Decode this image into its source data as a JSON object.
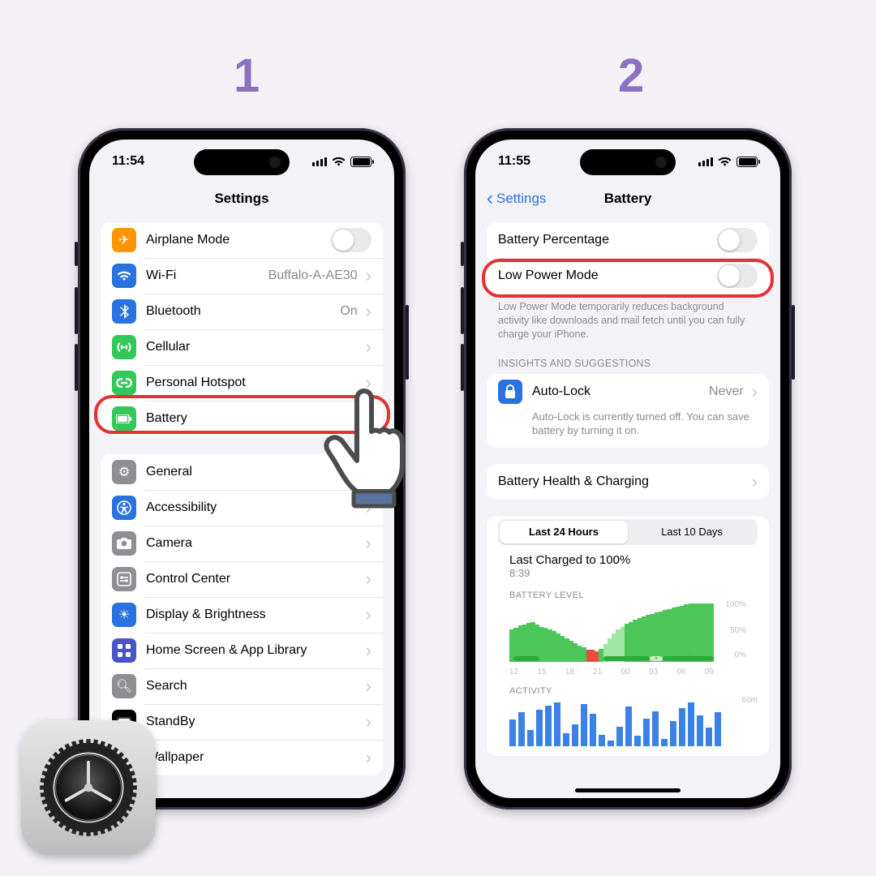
{
  "steps": {
    "one": "1",
    "two": "2"
  },
  "p1": {
    "time": "11:54",
    "title": "Settings",
    "groups": [
      {
        "items": [
          {
            "label": "Airplane Mode"
          },
          {
            "label": "Wi-Fi",
            "value": "Buffalo-A-AE30"
          },
          {
            "label": "Bluetooth",
            "value": "On"
          },
          {
            "label": "Cellular"
          },
          {
            "label": "Personal Hotspot"
          },
          {
            "label": "Battery"
          }
        ]
      },
      {
        "items": [
          {
            "label": "General"
          },
          {
            "label": "Accessibility"
          },
          {
            "label": "Camera"
          },
          {
            "label": "Control Center"
          },
          {
            "label": "Display & Brightness"
          },
          {
            "label": "Home Screen & App Library"
          },
          {
            "label": "Search"
          },
          {
            "label": "StandBy"
          },
          {
            "label": "Wallpaper"
          }
        ]
      }
    ]
  },
  "p2": {
    "time": "11:55",
    "back": "Settings",
    "title": "Battery",
    "rows": {
      "percentage": "Battery Percentage",
      "lowpower": "Low Power Mode",
      "lowpower_note": "Low Power Mode temporarily reduces background activity like downloads and mail fetch until you can fully charge your iPhone.",
      "insights_header": "INSIGHTS AND SUGGESTIONS",
      "autolock": "Auto-Lock",
      "autolock_val": "Never",
      "autolock_note": "Auto-Lock is currently turned off. You can save battery by turning it on.",
      "health": "Battery Health & Charging",
      "seg_a": "Last 24 Hours",
      "seg_b": "Last 10 Days",
      "charged_title": "Last Charged to 100%",
      "charged_time": "8:39",
      "level_head": "BATTERY LEVEL",
      "activity_head": "ACTIVITY"
    }
  },
  "chart_data": {
    "type": "bar",
    "title": "BATTERY LEVEL",
    "ylabel": "Percent",
    "ylim": [
      0,
      100
    ],
    "y_ticks": [
      "100%",
      "50%",
      "0%"
    ],
    "x_ticks": [
      "12",
      "15",
      "18",
      "21",
      "00",
      "03",
      "06",
      "09"
    ],
    "series": [
      {
        "name": "battery_level_pct",
        "values": [
          55,
          58,
          62,
          64,
          66,
          68,
          64,
          60,
          58,
          55,
          52,
          48,
          44,
          40,
          36,
          32,
          28,
          24,
          20,
          20,
          18,
          22,
          30,
          40,
          48,
          55,
          60,
          65,
          68,
          72,
          75,
          78,
          80,
          82,
          84,
          86,
          88,
          90,
          92,
          94,
          96,
          98,
          99,
          100,
          100,
          100,
          100,
          100
        ]
      },
      {
        "name": "low_battery_flag",
        "values": [
          0,
          0,
          0,
          0,
          0,
          0,
          0,
          0,
          0,
          0,
          0,
          0,
          0,
          0,
          0,
          0,
          0,
          0,
          1,
          1,
          1,
          0,
          0,
          0,
          0,
          0,
          0,
          0,
          0,
          0,
          0,
          0,
          0,
          0,
          0,
          0,
          0,
          0,
          0,
          0,
          0,
          0,
          0,
          0,
          0,
          0,
          0,
          0
        ]
      }
    ],
    "charging_segments": [
      {
        "start_idx": 1,
        "end_idx": 6,
        "style": "solid"
      },
      {
        "start_idx": 22,
        "end_idx": 32,
        "style": "solid"
      },
      {
        "start_idx": 33,
        "end_idx": 35,
        "style": "pause"
      },
      {
        "start_idx": 36,
        "end_idx": 47,
        "style": "bolt"
      }
    ],
    "activity": {
      "type": "bar",
      "ylabel": "minutes",
      "ylim": [
        0,
        60
      ],
      "y_ticks": [
        "60m"
      ],
      "values": [
        36,
        46,
        22,
        50,
        55,
        60,
        18,
        30,
        58,
        44,
        15,
        8,
        26,
        54,
        14,
        38,
        48,
        10,
        34,
        52,
        60,
        42,
        25,
        46
      ]
    }
  }
}
